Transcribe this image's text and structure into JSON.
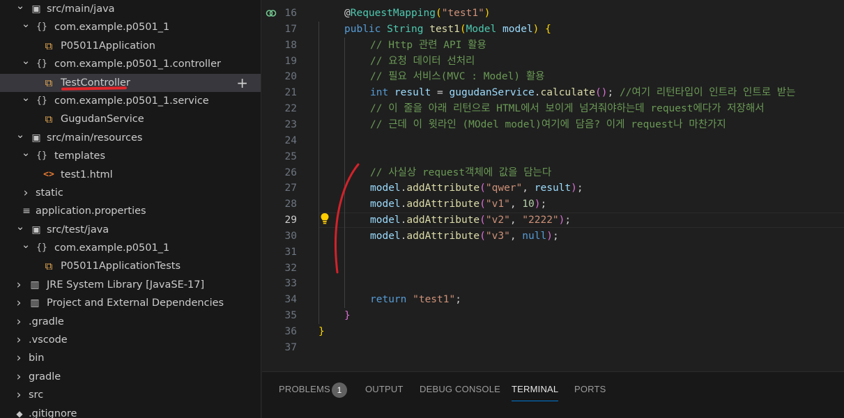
{
  "explorer": {
    "rows": [
      {
        "label": "src/main/java",
        "icon": "folder-library-icon",
        "expanded": true
      },
      {
        "label": "com.example.p0501_1",
        "icon": "package-icon",
        "expanded": true
      },
      {
        "label": "P05011Application",
        "icon": "java-class-icon"
      },
      {
        "label": "com.example.p0501_1.controller",
        "icon": "package-icon",
        "expanded": true
      },
      {
        "label": "TestController",
        "icon": "java-class-icon",
        "selected": true
      },
      {
        "label": "com.example.p0501_1.service",
        "icon": "package-icon",
        "expanded": true
      },
      {
        "label": "GugudanService",
        "icon": "java-class-icon"
      },
      {
        "label": "src/main/resources",
        "icon": "folder-library-icon",
        "expanded": true
      },
      {
        "label": "templates",
        "icon": "package-icon",
        "expanded": true
      },
      {
        "label": "test1.html",
        "icon": "html-file-icon"
      },
      {
        "label": "static",
        "icon": "",
        "expanded": false
      },
      {
        "label": "application.properties",
        "icon": "properties-file-icon"
      },
      {
        "label": "src/test/java",
        "icon": "folder-library-icon",
        "expanded": true
      },
      {
        "label": "com.example.p0501_1",
        "icon": "package-icon",
        "expanded": true
      },
      {
        "label": "P05011ApplicationTests",
        "icon": "java-class-icon"
      },
      {
        "label": "JRE System Library [JavaSE-17]",
        "icon": "library-icon",
        "expanded": false
      },
      {
        "label": "Project and External Dependencies",
        "icon": "library-icon",
        "expanded": false
      },
      {
        "label": ".gradle",
        "icon": "",
        "expanded": false
      },
      {
        "label": ".vscode",
        "icon": "",
        "expanded": false
      },
      {
        "label": "bin",
        "icon": "",
        "expanded": false
      },
      {
        "label": "gradle",
        "icon": "",
        "expanded": false
      },
      {
        "label": "src",
        "icon": "",
        "expanded": false
      },
      {
        "label": ".gitignore",
        "icon": "git-file-icon"
      }
    ],
    "add_button": "+"
  },
  "editor": {
    "active_line": "29",
    "lines": [
      {
        "n": "16",
        "tokens": [
          [
            "pl",
            "@"
          ],
          [
            "ty",
            "RequestMapping"
          ],
          [
            "br1",
            "("
          ],
          [
            "str",
            "\"test1\""
          ],
          [
            "br1",
            ")"
          ]
        ]
      },
      {
        "n": "17",
        "tokens": [
          [
            "kw",
            "public "
          ],
          [
            "ty",
            "String "
          ],
          [
            "fn",
            "test1"
          ],
          [
            "br1",
            "("
          ],
          [
            "ty",
            "Model "
          ],
          [
            "var",
            "model"
          ],
          [
            "br1",
            ")"
          ],
          [
            "pl",
            " "
          ],
          [
            "br1",
            "{"
          ]
        ]
      },
      {
        "n": "18",
        "tokens": [
          [
            "cm",
            "// Http 관련 API 활용"
          ]
        ]
      },
      {
        "n": "19",
        "tokens": [
          [
            "cm",
            "// 요청 데이터 선처리"
          ]
        ]
      },
      {
        "n": "20",
        "tokens": [
          [
            "cm",
            "// 필요 서비스(MVC : Model) 활용"
          ]
        ]
      },
      {
        "n": "21",
        "tokens": [
          [
            "kw",
            "int "
          ],
          [
            "var",
            "result"
          ],
          [
            "pl",
            " = "
          ],
          [
            "var",
            "gugudanService"
          ],
          [
            "pl",
            "."
          ],
          [
            "fn",
            "calculate"
          ],
          [
            "br2",
            "()"
          ],
          [
            "pl",
            "; "
          ],
          [
            "cm",
            "//여기 리턴타입이 인트라 인트로 받는"
          ]
        ]
      },
      {
        "n": "22",
        "tokens": [
          [
            "cm",
            "// 이 줄을 아래 리턴으로 HTML에서 보이게 넘겨줘야하는데 request에다가 저장해서"
          ]
        ]
      },
      {
        "n": "23",
        "tokens": [
          [
            "cm",
            "// 근데 이 윗라인 (MOdel model)여기에 담음? 이게 request나 마찬가지"
          ]
        ]
      },
      {
        "n": "24",
        "tokens": []
      },
      {
        "n": "25",
        "tokens": []
      },
      {
        "n": "26",
        "tokens": [
          [
            "cm",
            "// 사실상 request객체에 값을 담는다"
          ]
        ]
      },
      {
        "n": "27",
        "tokens": [
          [
            "var",
            "model"
          ],
          [
            "pl",
            "."
          ],
          [
            "fn",
            "addAttribute"
          ],
          [
            "br2",
            "("
          ],
          [
            "str",
            "\"qwer\""
          ],
          [
            "pl",
            ", "
          ],
          [
            "var",
            "result"
          ],
          [
            "br2",
            ")"
          ],
          [
            "pl",
            ";"
          ]
        ]
      },
      {
        "n": "28",
        "tokens": [
          [
            "var",
            "model"
          ],
          [
            "pl",
            "."
          ],
          [
            "fn",
            "addAttribute"
          ],
          [
            "br2",
            "("
          ],
          [
            "str",
            "\"v1\""
          ],
          [
            "pl",
            ", "
          ],
          [
            "num",
            "10"
          ],
          [
            "br2",
            ")"
          ],
          [
            "pl",
            ";"
          ]
        ]
      },
      {
        "n": "29",
        "tokens": [
          [
            "var",
            "model"
          ],
          [
            "pl",
            "."
          ],
          [
            "fn",
            "addAttribute"
          ],
          [
            "br2",
            "("
          ],
          [
            "str",
            "\"v2\""
          ],
          [
            "pl",
            ", "
          ],
          [
            "str",
            "\"2222\""
          ],
          [
            "br2",
            ")"
          ],
          [
            "pl",
            ";"
          ]
        ]
      },
      {
        "n": "30",
        "tokens": [
          [
            "var",
            "model"
          ],
          [
            "pl",
            "."
          ],
          [
            "fn",
            "addAttribute"
          ],
          [
            "br2",
            "("
          ],
          [
            "str",
            "\"v3\""
          ],
          [
            "pl",
            ", "
          ],
          [
            "kw",
            "null"
          ],
          [
            "br2",
            ")"
          ],
          [
            "pl",
            ";"
          ]
        ]
      },
      {
        "n": "31",
        "tokens": []
      },
      {
        "n": "32",
        "tokens": []
      },
      {
        "n": "33",
        "tokens": []
      },
      {
        "n": "34",
        "tokens": [
          [
            "kw",
            "return "
          ],
          [
            "str",
            "\"test1\""
          ],
          [
            "pl",
            ";"
          ]
        ]
      },
      {
        "n": "35",
        "tokens": [
          [
            "br2",
            "}"
          ]
        ]
      },
      {
        "n": "36",
        "tokens": [
          [
            "br1",
            "}"
          ]
        ]
      },
      {
        "n": "37",
        "tokens": []
      }
    ],
    "indent_levels": {
      "16": 1,
      "17": 1,
      "18": 2,
      "19": 2,
      "20": 2,
      "21": 2,
      "22": 2,
      "23": 2,
      "24": 2,
      "25": 2,
      "26": 2,
      "27": 2,
      "28": 2,
      "29": 2,
      "30": 2,
      "31": 2,
      "32": 2,
      "33": 2,
      "34": 2,
      "35": 1,
      "36": 0,
      "37": 0
    }
  },
  "panel": {
    "tabs": [
      {
        "label": "PROBLEMS",
        "key": "problems"
      },
      {
        "label": "OUTPUT",
        "key": "output"
      },
      {
        "label": "DEBUG CONSOLE",
        "key": "debug"
      },
      {
        "label": "TERMINAL",
        "key": "terminal",
        "active": true
      },
      {
        "label": "PORTS",
        "key": "ports"
      }
    ],
    "problems_count": "1"
  },
  "colors": {
    "accent": "#0078d4",
    "annotation_red": "#e3262a",
    "lightbulb": "#ffcc00"
  }
}
